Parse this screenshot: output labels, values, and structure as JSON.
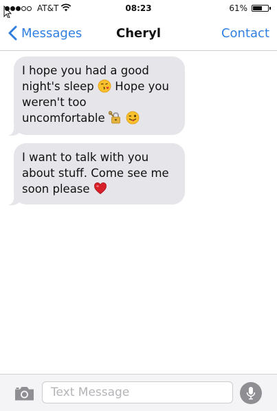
{
  "status_bar": {
    "carrier": "AT&T",
    "time": "08:23",
    "battery_percent": "61%",
    "battery_level": 0.61,
    "signal_bars_filled": 3,
    "signal_bars_total": 5
  },
  "nav": {
    "back_label": "Messages",
    "title": "Cheryl",
    "contact_label": "Contact",
    "accent_color": "#2f7ee2"
  },
  "messages": [
    {
      "direction": "incoming",
      "lines": [
        "I hope you had a good",
        "night's sleep",
        "Hope you",
        "weren't too",
        "uncomfortable"
      ],
      "emojis": [
        "kissing-face-emoji",
        "lock-with-key-emoji",
        "winking-tongue-face-emoji"
      ]
    },
    {
      "direction": "incoming",
      "lines": [
        "I want to talk with you",
        "about stuff. Come see me",
        "soon please"
      ],
      "emojis": [
        "red-heart-emoji"
      ]
    }
  ],
  "composer": {
    "placeholder": "Text Message",
    "value": ""
  },
  "colors": {
    "incoming_bubble": "#e5e5ea",
    "mic_button": "#8e8e93"
  }
}
